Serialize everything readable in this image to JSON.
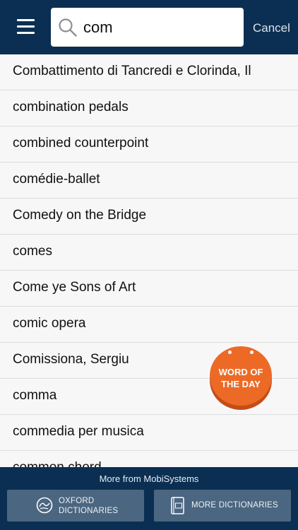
{
  "header": {
    "search": {
      "value": "com",
      "placeholder": ""
    },
    "cancel_label": "Cancel"
  },
  "results": [
    "Combattimento di Tancredi e Clorinda, Il",
    "combination pedals",
    "combined counterpoint",
    "comédie-ballet",
    "Comedy on the Bridge",
    "comes",
    "Come ye Sons of Art",
    "comic opera",
    "Comissiona, Sergiu",
    "comma",
    "commedia per musica",
    "common chord"
  ],
  "word_of_day": {
    "line1": "WORD OF",
    "line2": "THE DAY"
  },
  "footer": {
    "title": "More from MobiSystems",
    "oxford": {
      "line1": "OXFORD",
      "line2": "DICTIONARIES"
    },
    "more_label": "MORE DICTIONARIES"
  },
  "colors": {
    "navbar": "#0b2f52",
    "accent": "#ec6a26",
    "footer_button": "#4b6680"
  },
  "icons": [
    "menu-icon",
    "search-icon",
    "oxford-globe-icon",
    "dictionary-book-icon"
  ]
}
